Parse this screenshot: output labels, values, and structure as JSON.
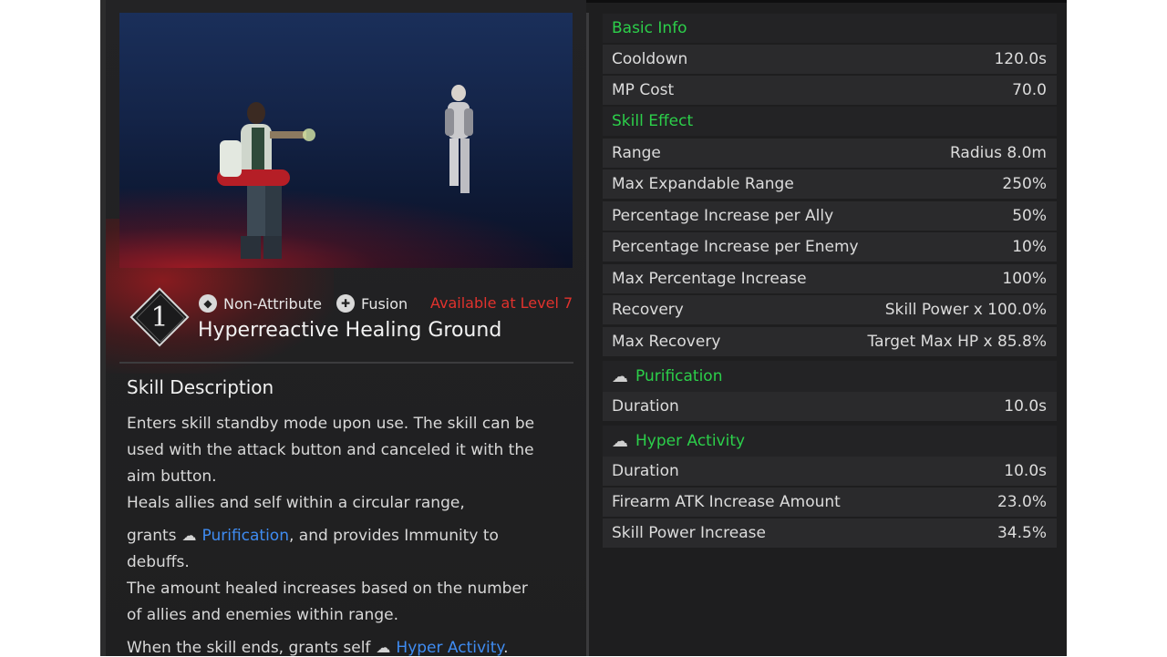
{
  "skill": {
    "number": "1",
    "attribute_label": "Non-Attribute",
    "type_label": "Fusion",
    "availability": "Available at Level 7",
    "title": "Hyperreactive Healing Ground",
    "icons": {
      "attribute": "non-attribute-icon",
      "type": "fusion-icon"
    }
  },
  "description": {
    "heading": "Skill Description",
    "line1": "Enters skill standby mode upon use. The skill can be",
    "line2": "used with the attack button and canceled it with the",
    "line3": "aim button.",
    "line4": "Heals allies and self within a circular range,",
    "line5_pre": "grants",
    "line5_link": "Purification",
    "line5_post": ", and provides Immunity to",
    "line6": "debuffs.",
    "line7": "The amount healed increases based on the number",
    "line8": "of allies and enemies within range.",
    "line9_pre": "When the skill ends, grants self",
    "line9_link": "Hyper Activity",
    "line9_post": "."
  },
  "stats": {
    "basic_info": "Basic Info",
    "cooldown": {
      "label": "Cooldown",
      "value": "120.0s"
    },
    "mp_cost": {
      "label": "MP Cost",
      "value": "70.0"
    },
    "skill_effect": "Skill Effect",
    "range": {
      "label": "Range",
      "value": "Radius 8.0m"
    },
    "max_expandable_range": {
      "label": "Max Expandable Range",
      "value": "250%"
    },
    "pct_ally": {
      "label": "Percentage Increase per Ally",
      "value": "50%"
    },
    "pct_enemy": {
      "label": "Percentage Increase per Enemy",
      "value": "10%"
    },
    "max_pct": {
      "label": "Max Percentage Increase",
      "value": "100%"
    },
    "recovery": {
      "label": "Recovery",
      "value": "Skill Power x 100.0%"
    },
    "max_recovery": {
      "label": "Max Recovery",
      "value": "Target Max HP x 85.8%"
    },
    "purification": {
      "label": "Purification",
      "icon": "purification-icon"
    },
    "purification_duration": {
      "label": "Duration",
      "value": "10.0s"
    },
    "hyper_activity": {
      "label": "Hyper Activity",
      "icon": "hyper-activity-icon"
    },
    "hyper_duration": {
      "label": "Duration",
      "value": "10.0s"
    },
    "firearm_atk": {
      "label": "Firearm ATK Increase Amount",
      "value": "23.0%"
    },
    "skill_power": {
      "label": "Skill Power Increase",
      "value": "34.5%"
    }
  },
  "colors": {
    "accent_green": "#2ccf4a",
    "link_blue": "#3f8cf2",
    "warning_red": "#e1322d"
  }
}
